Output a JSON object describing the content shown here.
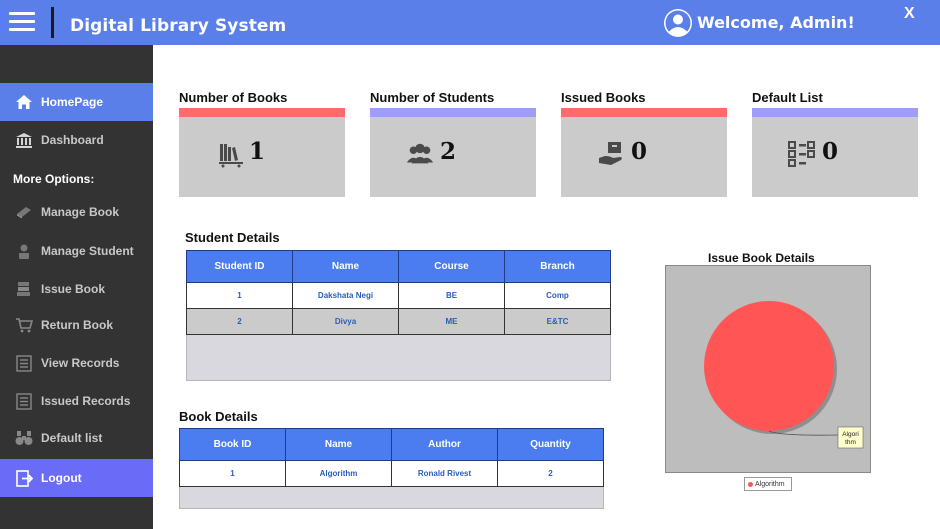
{
  "header": {
    "title": "Digital Library System",
    "welcome": "Welcome, Admin!",
    "close_label": "X"
  },
  "sidebar": {
    "items": [
      {
        "label": "HomePage",
        "icon": "home-icon",
        "active": true
      },
      {
        "label": "Dashboard",
        "icon": "bank-icon"
      }
    ],
    "more_options_label": "More Options:",
    "options": [
      {
        "label": "Manage Book",
        "icon": "book-icon"
      },
      {
        "label": "Manage Student",
        "icon": "person-icon"
      },
      {
        "label": "Issue Book",
        "icon": "book-stack-icon"
      },
      {
        "label": "Return Book",
        "icon": "cart-return-icon"
      },
      {
        "label": "View Records",
        "icon": "list-icon"
      },
      {
        "label": "Issued Records",
        "icon": "list-icon"
      },
      {
        "label": "Default list",
        "icon": "binoculars-icon"
      }
    ],
    "logout_label": "Logout"
  },
  "cards": [
    {
      "title": "Number of Books",
      "value": "1",
      "bar_color": "#ff6a6a",
      "icon": "library-icon"
    },
    {
      "title": "Number of Students",
      "value": "2",
      "bar_color": "#9e9ef5",
      "icon": "group-icon"
    },
    {
      "title": "Issued Books",
      "value": "0",
      "bar_color": "#ff6a6a",
      "icon": "hand-book-icon"
    },
    {
      "title": "Default List",
      "value": "0",
      "bar_color": "#9e9ef5",
      "icon": "checklist-icon"
    }
  ],
  "student_details": {
    "title": "Student Details",
    "columns": [
      "Student ID",
      "Name",
      "Course",
      "Branch"
    ],
    "rows": [
      [
        "1",
        "Dakshata Negi",
        "BE",
        "Comp"
      ],
      [
        "2",
        "Divya",
        "ME",
        "E&TC"
      ]
    ]
  },
  "book_details": {
    "title": "Book Details",
    "columns": [
      "Book ID",
      "Name",
      "Author",
      "Quantity"
    ],
    "rows": [
      [
        "1",
        "Algorithm",
        "Ronald Rivest",
        "2"
      ]
    ]
  },
  "chart_data": {
    "type": "pie",
    "title": "Issue Book Details",
    "categories": [
      "Algorithm"
    ],
    "values": [
      100
    ],
    "colors": [
      "#ff5555"
    ],
    "slice_label": "Algorithm",
    "legend_placement": "bottom"
  }
}
